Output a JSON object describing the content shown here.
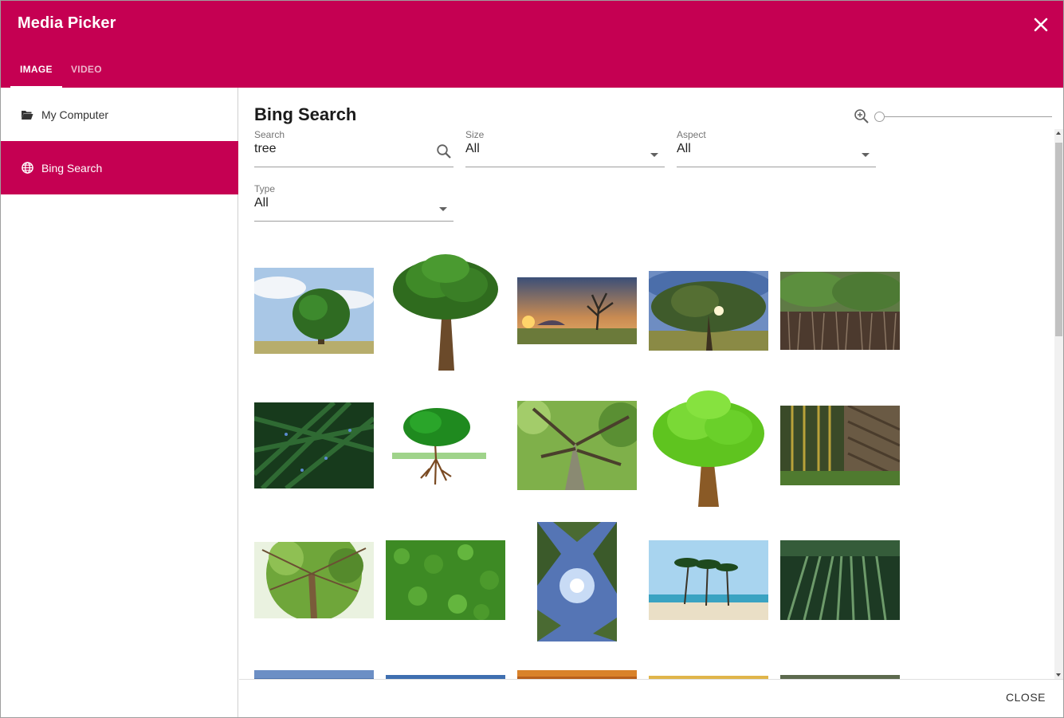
{
  "window": {
    "title": "Media Picker"
  },
  "tabs": [
    {
      "label": "IMAGE",
      "active": true
    },
    {
      "label": "VIDEO",
      "active": false
    }
  ],
  "sidebar": {
    "items": [
      {
        "label": "My Computer",
        "icon": "folder-open-icon",
        "active": false
      },
      {
        "label": "Bing Search",
        "icon": "globe-icon",
        "active": true
      }
    ]
  },
  "main": {
    "title": "Bing Search"
  },
  "filters": {
    "search": {
      "label": "Search",
      "value": "tree"
    },
    "size": {
      "label": "Size",
      "value": "All"
    },
    "aspect": {
      "label": "Aspect",
      "value": "All"
    },
    "type": {
      "label": "Type",
      "value": "All"
    }
  },
  "zoom": {
    "icon": "zoom-in-icon",
    "level": 0
  },
  "results": [
    {
      "subject": "tree-field-sky"
    },
    {
      "subject": "cartoon-tree"
    },
    {
      "subject": "sunset-tree"
    },
    {
      "subject": "wide-oak"
    },
    {
      "subject": "mangrove"
    },
    {
      "subject": "conifer-branches"
    },
    {
      "subject": "tree-with-roots"
    },
    {
      "subject": "trunk-canopy-up"
    },
    {
      "subject": "green-cartoon-tree"
    },
    {
      "subject": "bamboo-wall"
    },
    {
      "subject": "palm-canopy-up"
    },
    {
      "subject": "ivy-wall"
    },
    {
      "subject": "sun-through-leaves"
    },
    {
      "subject": "palm-beach"
    },
    {
      "subject": "bamboo-forest"
    },
    {
      "subject": "sky-partial"
    },
    {
      "subject": "coast-partial"
    },
    {
      "subject": "autumn-partial"
    },
    {
      "subject": "autumn-yellow-partial"
    },
    {
      "subject": "forest-partial"
    }
  ],
  "footer": {
    "close_label": "CLOSE"
  },
  "colors": {
    "accent": "#c50052"
  }
}
